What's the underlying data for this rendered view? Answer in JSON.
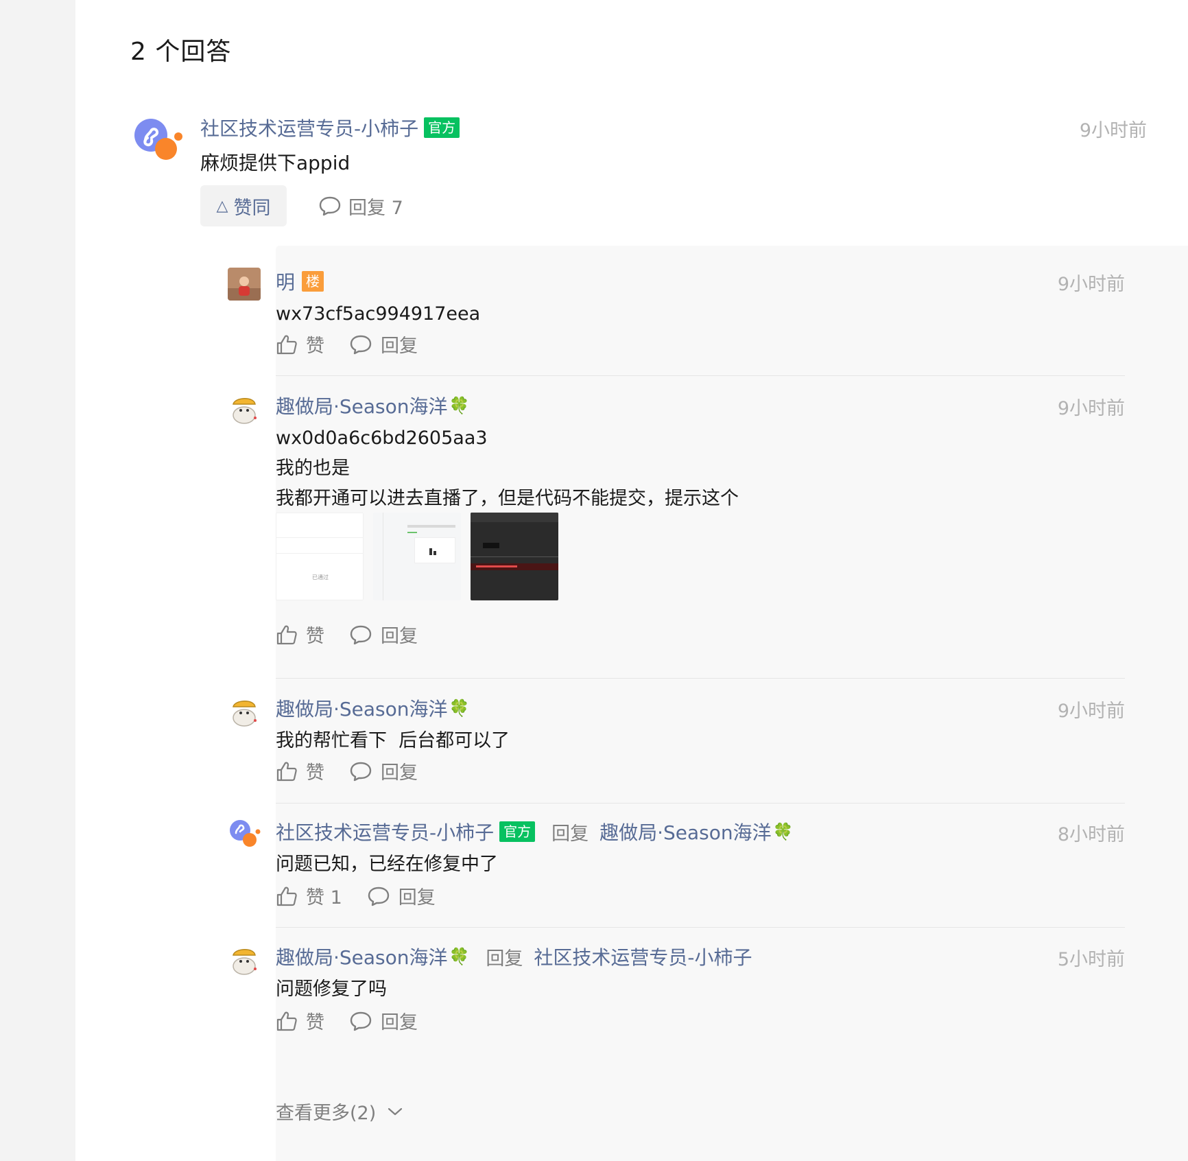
{
  "section": {
    "title": "2 个回答"
  },
  "answer": {
    "author": "社区技术运营专员-小柿子",
    "badge": "官方",
    "time": "9小时前",
    "content": "麻烦提供下appid",
    "agree_label": "赞同",
    "reply_label": "回复 7"
  },
  "replies": [
    {
      "author": "明",
      "badge": "楼",
      "time": "9小时前",
      "lines": [
        "wx73cf5ac994917eea"
      ],
      "like_label": "赞",
      "reply_label": "回复"
    },
    {
      "author": "趣做局·Season海洋",
      "emoji": "🍀",
      "time": "9小时前",
      "lines": [
        "wx0d0a6c6bd2605aa3",
        "我的也是",
        "我都开通可以进去直播了，但是代码不能提交，提示这个"
      ],
      "like_label": "赞",
      "reply_label": "回复",
      "thumb_text": "已通过"
    },
    {
      "author": "趣做局·Season海洋",
      "emoji": "🍀",
      "time": "9小时前",
      "lines": [
        "我的帮忙看下  后台都可以了"
      ],
      "like_label": "赞",
      "reply_label": "回复"
    },
    {
      "author": "社区技术运营专员-小柿子",
      "badge": "官方",
      "reply_to_label": "回复",
      "reply_to": "趣做局·Season海洋",
      "reply_to_emoji": "🍀",
      "time": "8小时前",
      "lines": [
        "问题已知，已经在修复中了"
      ],
      "like_label": "赞 1",
      "reply_label": "回复"
    },
    {
      "author": "趣做局·Season海洋",
      "emoji": "🍀",
      "reply_to_label": "回复",
      "reply_to": "社区技术运营专员-小柿子",
      "time": "5小时前",
      "lines": [
        "问题修复了吗"
      ],
      "like_label": "赞",
      "reply_label": "回复"
    }
  ],
  "more_label": "查看更多(2)",
  "colors": {
    "link": "#576b95",
    "official": "#07c160",
    "floor": "#fa9d3b",
    "muted": "#b2b2b2"
  },
  "icons": [
    "miniprogram-logo-avatar",
    "thumb-up-icon",
    "comment-bubble-icon",
    "triangle-up-icon",
    "chevron-down-icon",
    "clover-emoji"
  ]
}
